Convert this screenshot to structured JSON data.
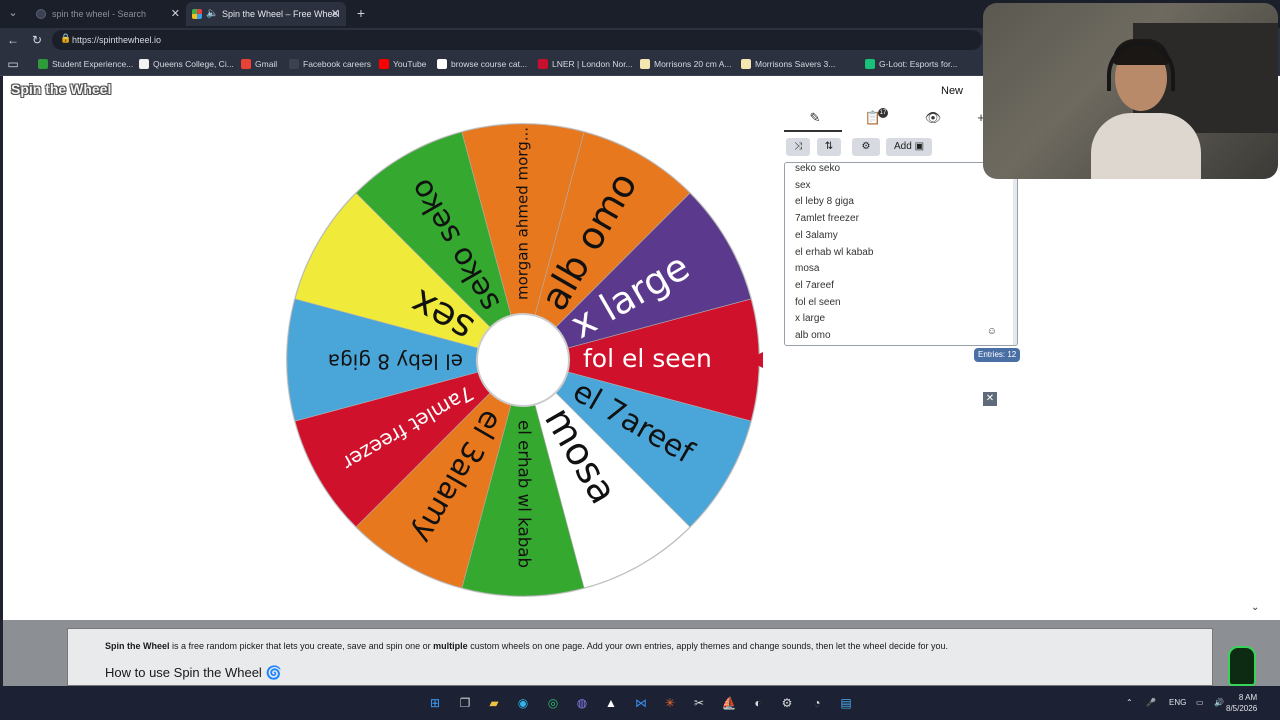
{
  "browser": {
    "tabs": [
      {
        "label": "spin the wheel - Search",
        "active": false
      },
      {
        "label": "Spin the Wheel – Free Wheel",
        "active": true
      }
    ],
    "new_tab": "+",
    "url": "https://spinthewheel.io",
    "bookmarks": [
      {
        "label": "Student Experience...",
        "color": "#2e9b3a"
      },
      {
        "label": "Queens College, Ci...",
        "color": "#f2f2f2"
      },
      {
        "label": "Gmail",
        "color": "#ea4335"
      },
      {
        "label": "Facebook careers",
        "color": "#3b4252"
      },
      {
        "label": "YouTube",
        "color": "#ff0000"
      },
      {
        "label": "browse course cat...",
        "color": "#ffffff"
      },
      {
        "label": "LNER | London Nor...",
        "color": "#c8102e"
      },
      {
        "label": "Morrisons 20 cm A...",
        "color": "#f4e6b0"
      },
      {
        "label": "Morrisons Savers 3...",
        "color": "#f4e6b0"
      },
      {
        "label": "G-Loot: Esports for...",
        "color": "#18c07a"
      }
    ]
  },
  "app": {
    "logo": "Spin the Wheel",
    "new_label": "New"
  },
  "wheel": {
    "segments": [
      {
        "label": "fol el seen",
        "color": "#d0112b",
        "text_color": "#ffffff"
      },
      {
        "label": "el 7areef",
        "color": "#4aa6d8",
        "text_color": "#111111"
      },
      {
        "label": "mosa",
        "color": "#ffffff",
        "text_color": "#111111"
      },
      {
        "label": "el erhab wl kabab",
        "color": "#35a82f",
        "text_color": "#111111"
      },
      {
        "label": "el 3alamy",
        "color": "#e8781e",
        "text_color": "#111111"
      },
      {
        "label": "7amlet freezer",
        "color": "#d0112b",
        "text_color": "#ffffff"
      },
      {
        "label": "el leby 8 giga",
        "color": "#4aa6d8",
        "text_color": "#111111"
      },
      {
        "label": "sex",
        "color": "#f0ea3a",
        "text_color": "#111111"
      },
      {
        "label": "seko seko",
        "color": "#35a82f",
        "text_color": "#111111"
      },
      {
        "label": "morgan ahmed morg...",
        "color": "#e8781e",
        "text_color": "#111111"
      },
      {
        "label": "alb omo",
        "color": "#e8781e",
        "text_color": "#111111"
      },
      {
        "label": "x large",
        "color": "#5b3a8e",
        "text_color": "#ffffff"
      }
    ],
    "pointer_color": "#d0112b"
  },
  "editor": {
    "add_label": "Add",
    "entries": [
      "seko seko",
      "sex",
      "el leby 8 giga",
      "7amlet freezer",
      "el 3alamy",
      "el erhab wl kabab",
      "mosa",
      "el 7areef",
      "fol el seen",
      "x large",
      "alb omo"
    ],
    "entries_count": "Entries: 12",
    "badge": "17"
  },
  "info": {
    "brand": "Spin the Wheel",
    "text_a": " is a free random picker that lets you create, save and spin one or ",
    "text_bold": "multiple",
    "text_b": " custom wheels on one page. Add your own entries, apply themes and change sounds, then let the wheel decide for you.",
    "heading": "How to use Spin the Wheel",
    "heading_icon": "🌀"
  },
  "taskbar": {
    "lang": "ENG",
    "time": "8 AM",
    "date": "8/5/2026"
  }
}
